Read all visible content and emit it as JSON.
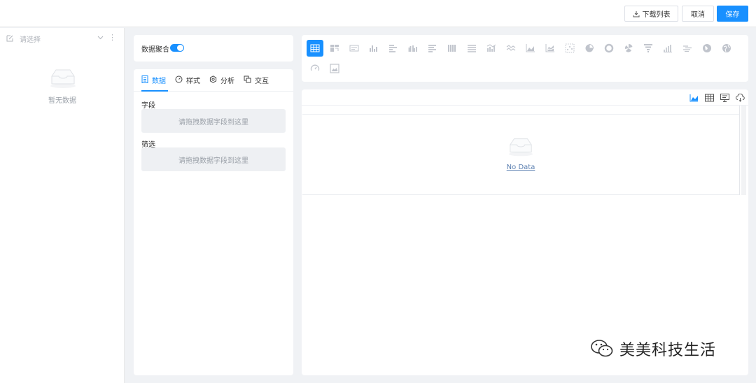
{
  "toolbar": {
    "download_label": "下载列表",
    "cancel_label": "取消",
    "save_label": "保存"
  },
  "sidebar": {
    "select_placeholder": "请选择",
    "empty_text": "暂无数据"
  },
  "aggregation": {
    "label": "数据聚合",
    "enabled": true
  },
  "config_tabs": [
    {
      "label": "数据",
      "icon": "data-icon",
      "active": true
    },
    {
      "label": "样式",
      "icon": "palette-icon",
      "active": false
    },
    {
      "label": "分析",
      "icon": "settings-icon",
      "active": false
    },
    {
      "label": "交互",
      "icon": "interaction-icon",
      "active": false
    }
  ],
  "fields": {
    "field_label": "字段",
    "field_drop_text": "请拖拽数据字段到这里",
    "filter_label": "筛选",
    "filter_drop_text": "请拖拽数据字段到这里"
  },
  "chart_types": [
    "table-icon",
    "pivot-table-icon",
    "card-icon",
    "bar-chart-icon",
    "horizontal-bar-icon",
    "grouped-bar-icon",
    "stacked-horizontal-bar-icon",
    "stacked-bar-icon",
    "percent-bar-icon",
    "combo-chart-icon",
    "line-chart-icon",
    "area-chart-icon",
    "stacked-area-icon",
    "scatter-icon",
    "pie-chart-icon",
    "donut-chart-icon",
    "rose-chart-icon",
    "funnel-chart-icon",
    "waterfall-icon",
    "word-cloud-icon",
    "map-icon",
    "globe-icon",
    "gauge-icon",
    "image-icon"
  ],
  "active_chart_type": "table-icon",
  "view_toolbar_icons": [
    "chart-view-icon",
    "table-view-icon",
    "screen-icon",
    "cloud-download-icon"
  ],
  "view": {
    "no_data_text": "No Data"
  },
  "watermark": {
    "text": "美美科技生活"
  },
  "colors": {
    "primary": "#1890ff",
    "icon_gray": "#c0c4cc"
  }
}
